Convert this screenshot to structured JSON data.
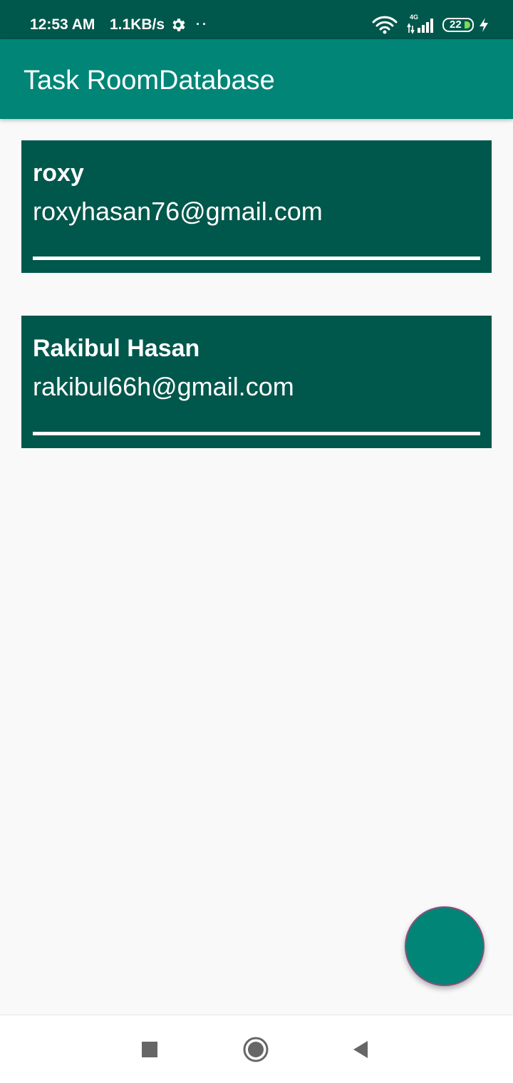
{
  "status_bar": {
    "time": "12:53 AM",
    "net_speed": "1.1KB/s",
    "settings_icon": "gear-icon",
    "notification_dots": "··",
    "network_type": "4G",
    "battery_level": "22",
    "battery_fill_color": "#7ed957"
  },
  "toolbar": {
    "title": "Task RoomDatabase"
  },
  "users": [
    {
      "name": "roxy",
      "email": "roxyhasan76@gmail.com"
    },
    {
      "name": "Rakibul Hasan",
      "email": "rakibul66h@gmail.com"
    }
  ],
  "fab": {
    "color": "#008577"
  },
  "nav_bar": {
    "recents_icon": "square-icon",
    "home_icon": "circle-icon",
    "back_icon": "triangle-back-icon"
  },
  "colors": {
    "primary": "#008577",
    "primary_dark": "#00574b",
    "background": "#f9f9fa"
  }
}
